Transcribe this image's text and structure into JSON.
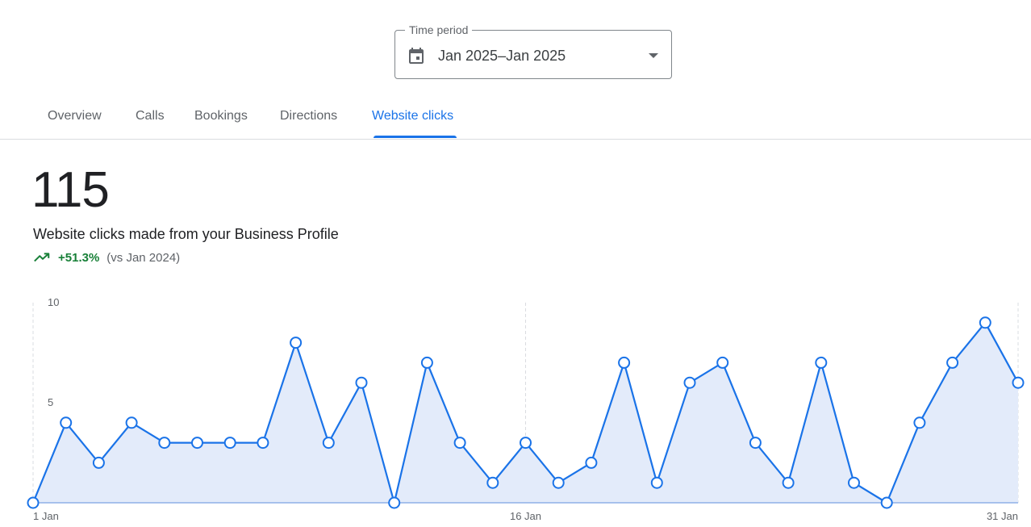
{
  "time_period": {
    "legend": "Time period",
    "value": "Jan 2025–Jan 2025",
    "calendar_icon": "calendar-icon",
    "dropdown_icon": "arrow-drop-down-icon"
  },
  "tabs": [
    {
      "label": "Overview",
      "active": false
    },
    {
      "label": "Calls",
      "active": false
    },
    {
      "label": "Bookings",
      "active": false
    },
    {
      "label": "Directions",
      "active": false
    },
    {
      "label": "Website clicks",
      "active": true
    }
  ],
  "summary": {
    "total": "115",
    "description": "Website clicks made from your Business Profile",
    "trend_icon": "trending-up-icon",
    "change": "+51.3%",
    "comparison": "(vs Jan 2024)"
  },
  "colors": {
    "accent": "#1a73e8",
    "fill": "#e3ebfa",
    "positive": "#188038"
  },
  "chart_data": {
    "type": "area",
    "x": [
      "1 Jan",
      "2 Jan",
      "3 Jan",
      "4 Jan",
      "5 Jan",
      "6 Jan",
      "7 Jan",
      "8 Jan",
      "9 Jan",
      "10 Jan",
      "11 Jan",
      "12 Jan",
      "13 Jan",
      "14 Jan",
      "15 Jan",
      "16 Jan",
      "17 Jan",
      "18 Jan",
      "19 Jan",
      "20 Jan",
      "21 Jan",
      "22 Jan",
      "23 Jan",
      "24 Jan",
      "25 Jan",
      "26 Jan",
      "27 Jan",
      "28 Jan",
      "29 Jan",
      "30 Jan",
      "31 Jan"
    ],
    "values": [
      0,
      4,
      2,
      4,
      3,
      3,
      3,
      3,
      8,
      3,
      6,
      0,
      7,
      3,
      1,
      3,
      1,
      2,
      7,
      1,
      6,
      7,
      3,
      1,
      7,
      1,
      0,
      4,
      7,
      9,
      6
    ],
    "x_ticks": [
      "1 Jan",
      "16 Jan",
      "31 Jan"
    ],
    "y_ticks": [
      "5",
      "10"
    ],
    "ylim": [
      0,
      10
    ],
    "grid": "vertical dashed at tick days"
  }
}
